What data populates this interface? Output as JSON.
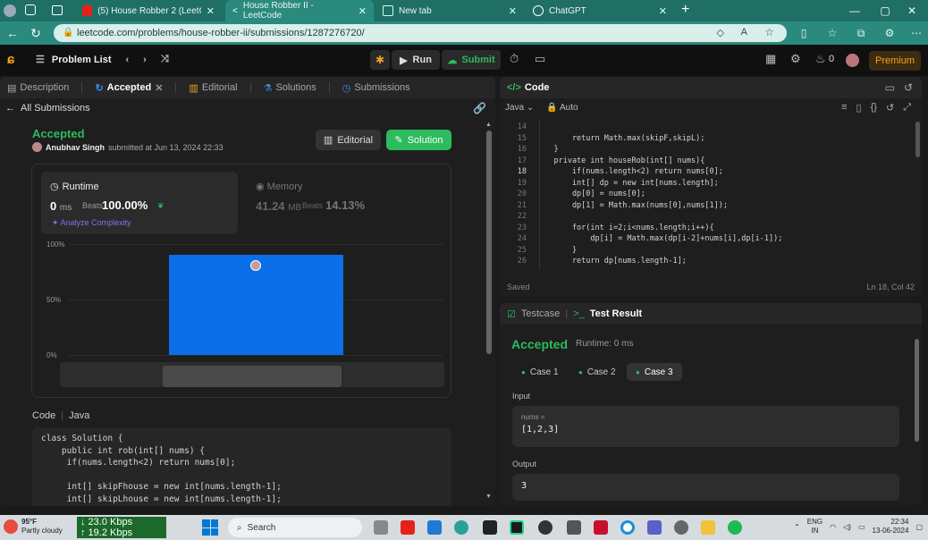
{
  "browser": {
    "tabs": [
      {
        "label": "(5) House Robber 2 (LeetCode 2",
        "active": false,
        "favicon": "youtube"
      },
      {
        "label": "House Robber II - LeetCode",
        "active": true,
        "favicon": "leetcode"
      },
      {
        "label": "New tab",
        "active": false,
        "favicon": "newtab"
      },
      {
        "label": "ChatGPT",
        "active": false,
        "favicon": "chatgpt"
      }
    ],
    "url": "leetcode.com/problems/house-robber-ii/submissions/1287276720/"
  },
  "lc_header": {
    "problem_list": "Problem List",
    "run": "Run",
    "submit": "Submit",
    "streak": "0",
    "premium": "Premium"
  },
  "left_tabs": [
    "Description",
    "Accepted",
    "Editorial",
    "Solutions",
    "Submissions"
  ],
  "submission": {
    "back_label": "All Submissions",
    "status": "Accepted",
    "author": "Anubhav Singh",
    "submitted_at": "submitted at Jun 13, 2024 22:33",
    "editorial_btn": "Editorial",
    "solution_btn": "Solution",
    "runtime": {
      "label": "Runtime",
      "value": "0",
      "unit": "ms",
      "beats_label": "Beats",
      "beats_pct": "100.00%",
      "analyze": "Analyze Complexity"
    },
    "memory": {
      "label": "Memory",
      "value": "41.24",
      "unit": "MB",
      "beats_label": "Beats",
      "beats_pct": "14.13%"
    },
    "code_label": "Code",
    "language": "Java",
    "code_lines": [
      "class Solution {",
      "    public int rob(int[] nums) {",
      "     if(nums.length<2) return nums[0];",
      "",
      "     int[] skipFhouse = new int[nums.length-1];",
      "     int[] skipLhouse = new int[nums.length-1];"
    ]
  },
  "chart_data": {
    "type": "bar",
    "categories": [
      "0 ms"
    ],
    "values": [
      100
    ],
    "yticks": [
      "100%",
      "50%",
      "0%"
    ],
    "ylim": [
      0,
      100
    ],
    "color": "#0a6fe8"
  },
  "editor": {
    "title": "Code",
    "language": "Java",
    "mode": "Auto",
    "status": "Saved",
    "cursor": "Ln 18, Col 42",
    "lines": [
      {
        "n": "14",
        "text": ""
      },
      {
        "n": "15",
        "text": "        return Math.max(skipF,skipL);"
      },
      {
        "n": "16",
        "text": "    }"
      },
      {
        "n": "17",
        "text": "    private int houseRob(int[] nums){"
      },
      {
        "n": "18",
        "text": "        if(nums.length<2) return nums[0];"
      },
      {
        "n": "19",
        "text": "        int[] dp = new int[nums.length];"
      },
      {
        "n": "20",
        "text": "        dp[0] = nums[0];"
      },
      {
        "n": "21",
        "text": "        dp[1] = Math.max(nums[0],nums[1]);"
      },
      {
        "n": "22",
        "text": ""
      },
      {
        "n": "23",
        "text": "        for(int i=2;i<nums.length;i++){"
      },
      {
        "n": "24",
        "text": "            dp[i] = Math.max(dp[i-2]+nums[i],dp[i-1]);"
      },
      {
        "n": "25",
        "text": "        }"
      },
      {
        "n": "26",
        "text": "        return dp[nums.length-1];"
      }
    ]
  },
  "result": {
    "tab_testcase": "Testcase",
    "tab_result": "Test Result",
    "status": "Accepted",
    "runtime": "Runtime: 0 ms",
    "cases": [
      "Case 1",
      "Case 2",
      "Case 3"
    ],
    "input_label": "Input",
    "input_var": "nums =",
    "input_value": "[1,2,3]",
    "output_label": "Output",
    "output_value": "3"
  },
  "taskbar": {
    "temp": "95°F",
    "weather": "Partly cloudy",
    "net_down": "↓ 23.0 Kbps",
    "net_up": "↑ 19.2 Kbps",
    "search": "Search",
    "lang1": "ENG",
    "lang2": "IN",
    "time": "22:34",
    "date": "13-06-2024"
  }
}
